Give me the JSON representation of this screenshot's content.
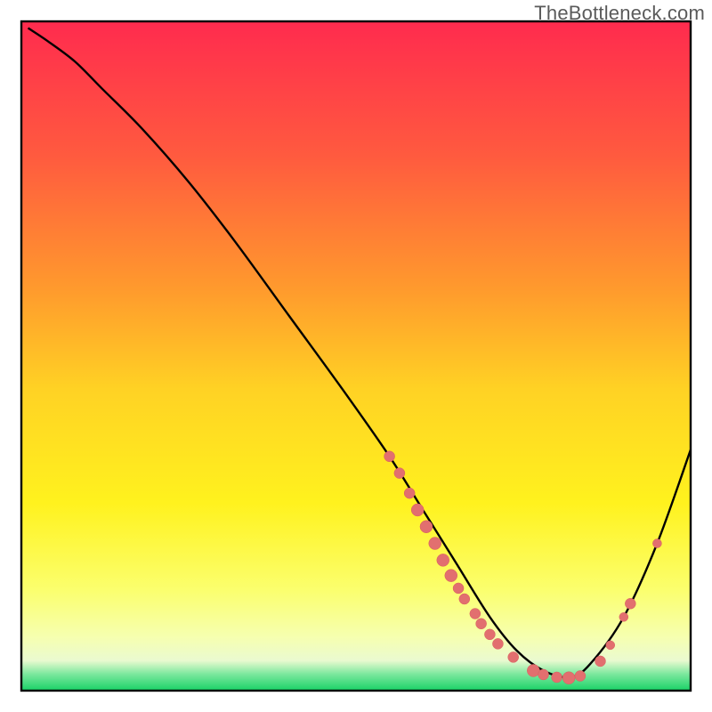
{
  "attribution": "TheBottleneck.com",
  "chart_data": {
    "type": "line",
    "title": "",
    "xlabel": "",
    "ylabel": "",
    "xlim": [
      0,
      100
    ],
    "ylim": [
      0,
      100
    ],
    "grid": false,
    "legend": false,
    "gradient_stops": [
      {
        "offset": 0.0,
        "color": "#ff2b4e"
      },
      {
        "offset": 0.2,
        "color": "#ff5a3f"
      },
      {
        "offset": 0.4,
        "color": "#ff9a2d"
      },
      {
        "offset": 0.55,
        "color": "#ffd224"
      },
      {
        "offset": 0.72,
        "color": "#fff21e"
      },
      {
        "offset": 0.85,
        "color": "#fbff6e"
      },
      {
        "offset": 0.92,
        "color": "#f6ffb0"
      },
      {
        "offset": 0.955,
        "color": "#eafad0"
      },
      {
        "offset": 0.975,
        "color": "#7de89e"
      },
      {
        "offset": 1.0,
        "color": "#19d267"
      }
    ],
    "series": [
      {
        "name": "bottleneck-curve",
        "color": "#000000",
        "x": [
          1,
          4,
          8,
          12,
          18,
          25,
          32,
          40,
          48,
          55,
          60,
          65,
          70,
          74,
          78,
          82,
          85,
          90,
          95,
          100
        ],
        "values": [
          99,
          97,
          94,
          90,
          84,
          76,
          67,
          56,
          45,
          35,
          27,
          19,
          11,
          6,
          3,
          2,
          4,
          11,
          22,
          36
        ]
      }
    ],
    "markers": {
      "color": "#e26f6f",
      "stroke": "#d85e5e",
      "points": [
        {
          "x": 55.0,
          "y": 35.0,
          "r": 6
        },
        {
          "x": 56.5,
          "y": 32.5,
          "r": 6
        },
        {
          "x": 58.0,
          "y": 29.5,
          "r": 6
        },
        {
          "x": 59.2,
          "y": 27.0,
          "r": 7
        },
        {
          "x": 60.5,
          "y": 24.5,
          "r": 7
        },
        {
          "x": 61.8,
          "y": 22.0,
          "r": 7
        },
        {
          "x": 63.0,
          "y": 19.5,
          "r": 7
        },
        {
          "x": 64.2,
          "y": 17.2,
          "r": 7
        },
        {
          "x": 65.3,
          "y": 15.3,
          "r": 6
        },
        {
          "x": 66.2,
          "y": 13.7,
          "r": 6
        },
        {
          "x": 67.8,
          "y": 11.5,
          "r": 6
        },
        {
          "x": 68.7,
          "y": 10.0,
          "r": 6
        },
        {
          "x": 70.0,
          "y": 8.4,
          "r": 6
        },
        {
          "x": 71.2,
          "y": 7.0,
          "r": 6
        },
        {
          "x": 73.5,
          "y": 5.0,
          "r": 6
        },
        {
          "x": 76.5,
          "y": 3.0,
          "r": 7
        },
        {
          "x": 78.0,
          "y": 2.4,
          "r": 6
        },
        {
          "x": 80.0,
          "y": 2.0,
          "r": 6
        },
        {
          "x": 81.8,
          "y": 1.9,
          "r": 7
        },
        {
          "x": 83.5,
          "y": 2.2,
          "r": 6
        },
        {
          "x": 86.5,
          "y": 4.4,
          "r": 6
        },
        {
          "x": 88.0,
          "y": 6.8,
          "r": 5
        },
        {
          "x": 90.0,
          "y": 11.0,
          "r": 5
        },
        {
          "x": 91.0,
          "y": 13.0,
          "r": 6
        },
        {
          "x": 95.0,
          "y": 22.0,
          "r": 5
        }
      ]
    }
  }
}
